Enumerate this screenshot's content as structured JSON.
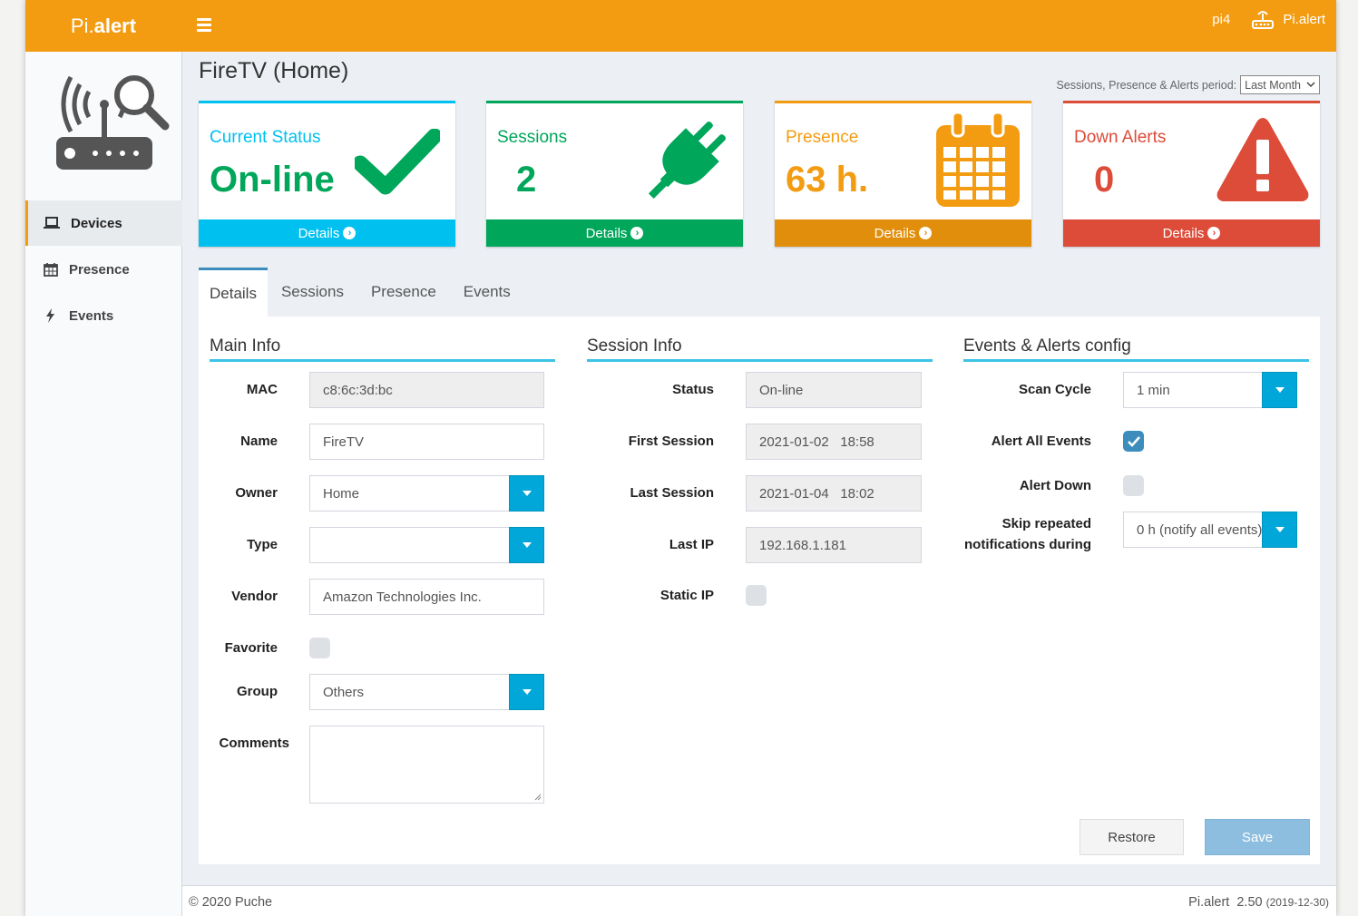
{
  "header": {
    "logo_prefix": "Pi.",
    "logo_bold": "alert",
    "host": "pi4",
    "user_label": "Pi.alert",
    "color": "#f39c12"
  },
  "sidebar": {
    "items": [
      {
        "label": "Devices",
        "icon": "laptop-icon"
      },
      {
        "label": "Presence",
        "icon": "calendar-icon"
      },
      {
        "label": "Events",
        "icon": "bolt-icon"
      }
    ]
  },
  "page": {
    "title": "FireTV (Home)",
    "period_label": "Sessions, Presence & Alerts period:",
    "period_value": "Last Month"
  },
  "boxes": [
    {
      "title": "Current Status",
      "value": "On-line",
      "footer": "Details",
      "color": "#00a65a",
      "top_color": "#00c0ef",
      "footer_color": "#00c0ef",
      "icon": "check-icon"
    },
    {
      "title": "Sessions",
      "value": "2",
      "footer": "Details",
      "color": "#00a65a",
      "top_color": "#00a65a",
      "footer_color": "#00a65a",
      "icon": "plug-icon"
    },
    {
      "title": "Presence",
      "value": "63 h.",
      "footer": "Details",
      "color": "#f39c12",
      "top_color": "#f39c12",
      "footer_color": "#e08e0b",
      "icon": "calendar-icon"
    },
    {
      "title": "Down Alerts",
      "value": "0",
      "footer": "Details",
      "color": "#dd4b39",
      "top_color": "#dd4b39",
      "footer_color": "#dd4b39",
      "icon": "warning-icon"
    }
  ],
  "tabs": [
    "Details",
    "Sessions",
    "Presence",
    "Events"
  ],
  "main_info": {
    "title": "Main Info",
    "mac_label": "MAC",
    "mac": "c8:6c:3d:bc",
    "name_label": "Name",
    "name": "FireTV",
    "owner_label": "Owner",
    "owner": "Home",
    "type_label": "Type",
    "type": "",
    "vendor_label": "Vendor",
    "vendor": "Amazon Technologies Inc.",
    "favorite_label": "Favorite",
    "group_label": "Group",
    "group": "Others",
    "comments_label": "Comments"
  },
  "session_info": {
    "title": "Session Info",
    "status_label": "Status",
    "status": "On-line",
    "first_label": "First Session",
    "first": "2021-01-02   18:58",
    "last_label": "Last Session",
    "last": "2021-01-04   18:02",
    "ip_label": "Last IP",
    "ip": "192.168.1.181",
    "static_label": "Static IP"
  },
  "alerts_config": {
    "title": "Events & Alerts config",
    "scan_label": "Scan Cycle",
    "scan": "1 min",
    "all_events_label": "Alert All Events",
    "down_label": "Alert Down",
    "skip_label_1": "Skip repeated",
    "skip_label_2": "notifications during",
    "skip": "0 h (notify all events)"
  },
  "buttons": {
    "restore": "Restore",
    "save": "Save"
  },
  "footer": {
    "copyright": "© 2020 Puche",
    "app": "Pi.alert  2.50",
    "date": "(2019-12-30)"
  }
}
